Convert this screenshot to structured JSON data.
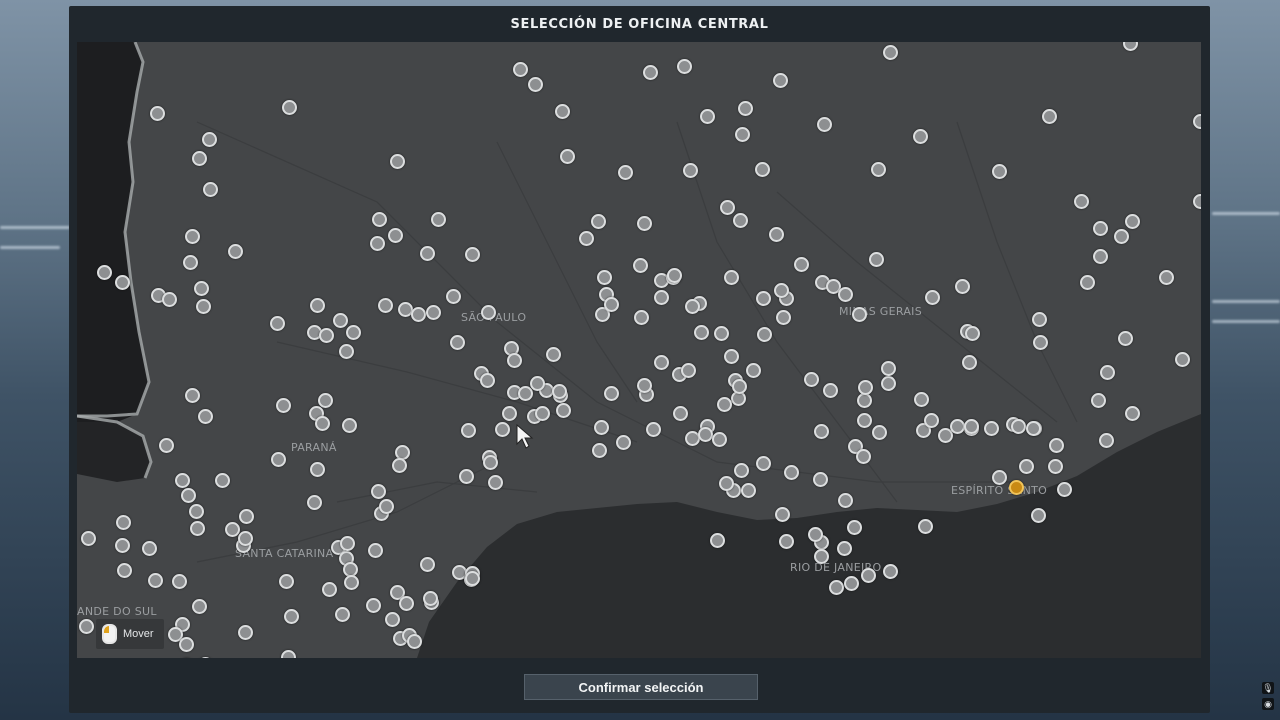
{
  "window": {
    "title": "SELECCIÓN DE OFICINA CENTRAL"
  },
  "map": {
    "regions": [
      {
        "id": "sao-paulo",
        "label": "SÃO PAULO"
      },
      {
        "id": "minas-gerais",
        "label": "MINAS GERAIS"
      },
      {
        "id": "parana",
        "label": "PARANÁ"
      },
      {
        "id": "santa-catarina",
        "label": "SANTA CATARINA"
      },
      {
        "id": "espirito-santo",
        "label": "ESPÍRITO SANTO"
      },
      {
        "id": "rio-de-janeiro",
        "label": "RIO DE JANEIRO"
      },
      {
        "id": "rio-grande-do-sul",
        "label": "ANDE DO SUL"
      }
    ],
    "cities_selected_count": 1,
    "move_hint": {
      "label": "Mover",
      "icon": "mouse-icon"
    }
  },
  "footer": {
    "confirm_label": "Confirmar selección"
  },
  "system_icons": [
    "microphone-icon",
    "record-icon"
  ],
  "colors": {
    "panel": "#20272d",
    "map_land": "#444648",
    "sea": "#2a2c2e",
    "city_dot": "#8d8f91",
    "city_selected": "#c98a14"
  }
}
